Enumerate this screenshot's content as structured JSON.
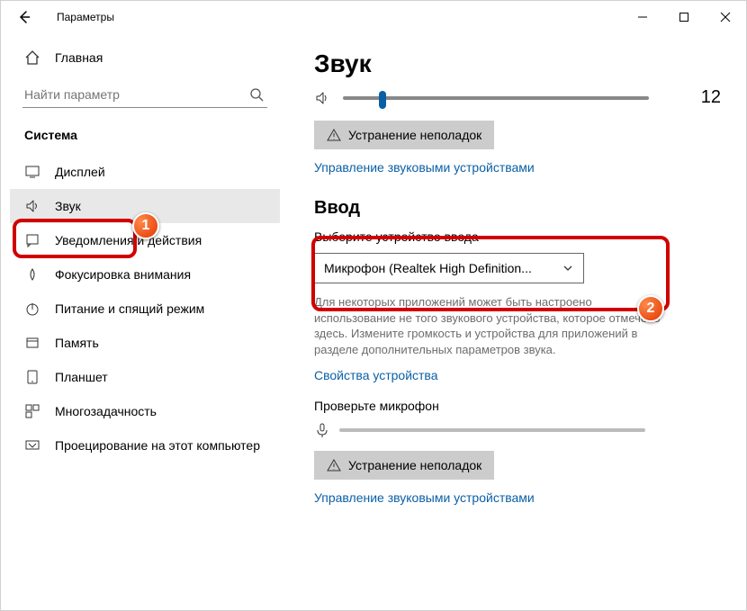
{
  "window": {
    "title": "Параметры"
  },
  "sidebar": {
    "home": "Главная",
    "search_placeholder": "Найти параметр",
    "category": "Система",
    "items": [
      {
        "label": "Дисплей",
        "icon": "display-icon"
      },
      {
        "label": "Звук",
        "icon": "sound-icon",
        "active": true
      },
      {
        "label": "Уведомления и действия",
        "icon": "notifications-icon"
      },
      {
        "label": "Фокусировка внимания",
        "icon": "focus-icon"
      },
      {
        "label": "Питание и спящий режим",
        "icon": "power-icon"
      },
      {
        "label": "Память",
        "icon": "storage-icon"
      },
      {
        "label": "Планшет",
        "icon": "tablet-icon"
      },
      {
        "label": "Многозадачность",
        "icon": "multitask-icon"
      },
      {
        "label": "Проецирование на этот компьютер",
        "icon": "project-icon"
      }
    ]
  },
  "main": {
    "title": "Звук",
    "volume_value": "12",
    "troubleshoot": "Устранение неполадок",
    "manage_devices": "Управление звуковыми устройствами",
    "input_heading": "Ввод",
    "choose_input": "Выберите устройство ввода",
    "input_device": "Микрофон (Realtek High Definition...",
    "input_note": "Для некоторых приложений может быть настроено использование не того звукового устройства, которое отмечено здесь. Измените громкость и устройства для приложений в разделе дополнительных параметров звука.",
    "device_props": "Свойства устройства",
    "test_mic": "Проверьте микрофон",
    "troubleshoot2": "Устранение неполадок",
    "manage_devices2": "Управление звуковыми устройствами"
  },
  "callouts": {
    "one": "1",
    "two": "2"
  }
}
